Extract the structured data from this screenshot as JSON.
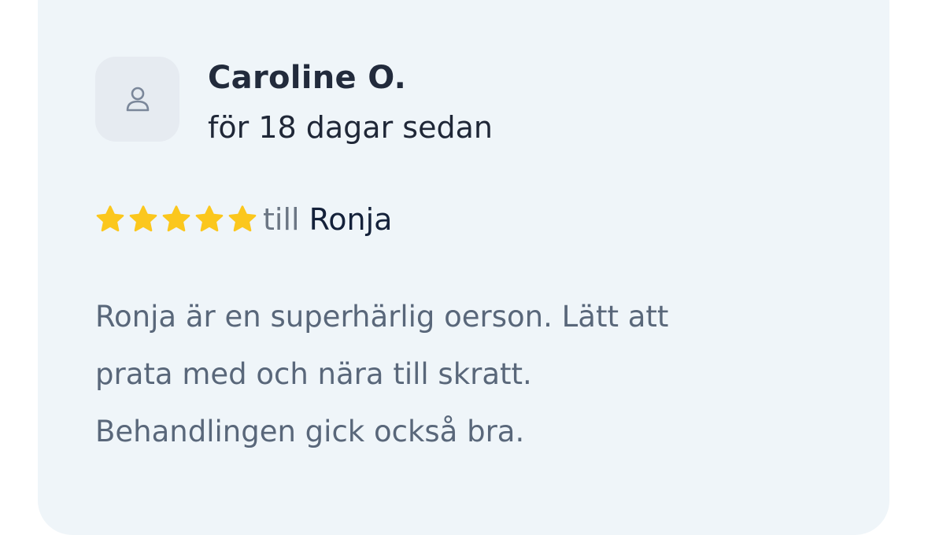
{
  "review": {
    "author": "Caroline O.",
    "time_ago": "för 18 dagar sedan",
    "rating": 5,
    "rating_max": 5,
    "till_label": "till",
    "therapist": "Ronja",
    "text_lines": [
      "Ronja är en superhärlig oerson. Lätt att",
      "prata med och nära till skratt.",
      "Behandlingen gick också bra."
    ]
  },
  "colors": {
    "card_background": "#eff5f9",
    "avatar_background": "#e6ebf1",
    "star": "#fbc71d",
    "author": "#222b3c",
    "body_text": "#59677a"
  },
  "icons": {
    "avatar": "user-icon",
    "rating": "star-icon"
  }
}
